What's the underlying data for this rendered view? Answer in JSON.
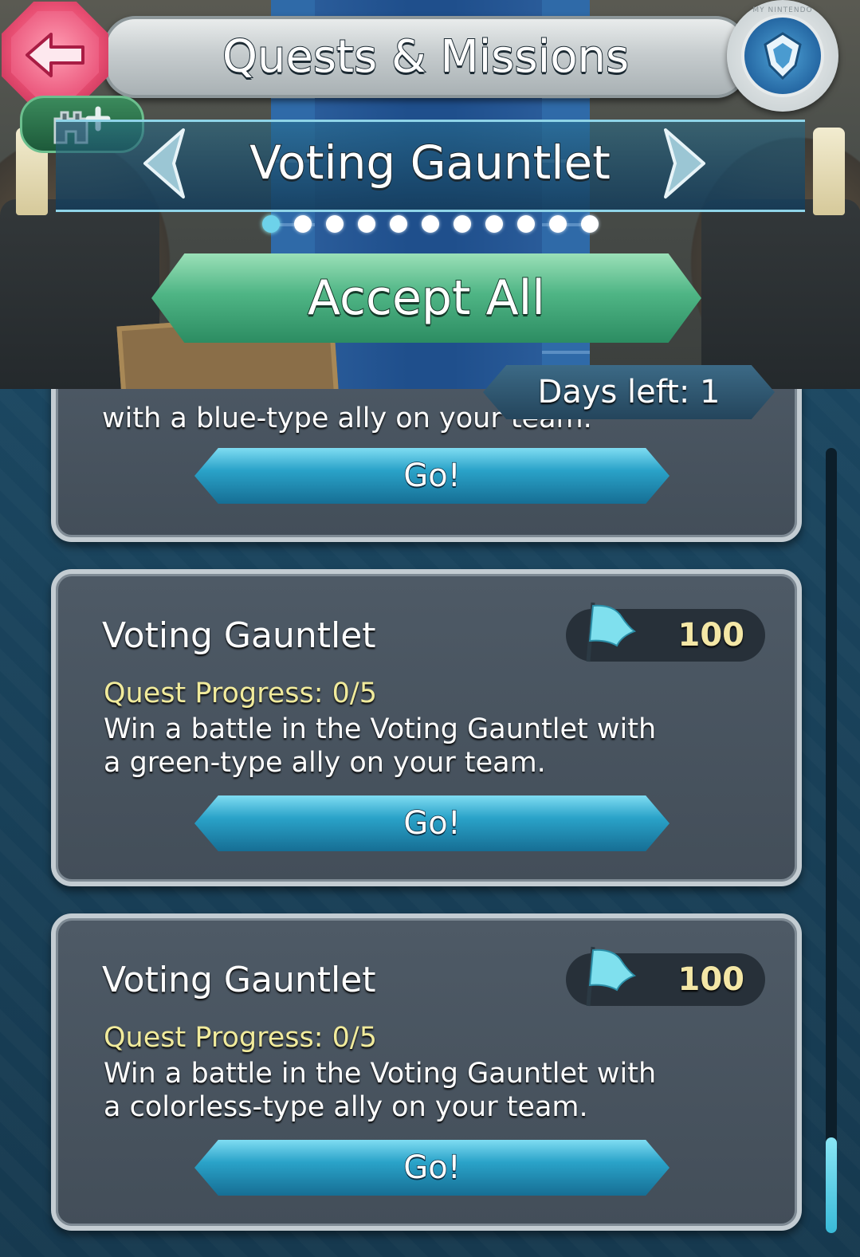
{
  "header": {
    "title": "Quests & Missions",
    "back_icon": "back-arrow-icon",
    "badge_icon": "my-nintendo-emblem-icon",
    "badge_ring_text": "MY NINTENDO",
    "castle_icon": "castle-plus-icon"
  },
  "category": {
    "title": "Voting Gauntlet",
    "page_count": 11,
    "active_page": 1,
    "prev_icon": "chevron-left-icon",
    "next_icon": "chevron-right-icon"
  },
  "accept_all_label": "Accept All",
  "days_left": "Days left: 1",
  "quests": [
    {
      "title": "",
      "progress": "",
      "description_line1": "with a blue-type ally on your team.",
      "go_label": "Go!"
    },
    {
      "title": "Voting Gauntlet",
      "reward": "100",
      "reward_icon": "feather-flag-icon",
      "progress": "Quest Progress: 0/5",
      "description_line1": "Win a battle in the Voting Gauntlet with",
      "description_line2": "a green-type ally on your team.",
      "go_label": "Go!"
    },
    {
      "title": "Voting Gauntlet",
      "reward": "100",
      "reward_icon": "feather-flag-icon",
      "progress": "Quest Progress: 0/5",
      "description_line1": "Win a battle in the Voting Gauntlet with",
      "description_line2": "a colorless-type ally on your team.",
      "go_label": "Go!"
    }
  ],
  "colors": {
    "accent": "#6dd2ea",
    "progress_text": "#f1eb9c",
    "reward_text": "#f4e7a6",
    "accept_green": "#4fb585",
    "back_pink": "#e94f73"
  }
}
